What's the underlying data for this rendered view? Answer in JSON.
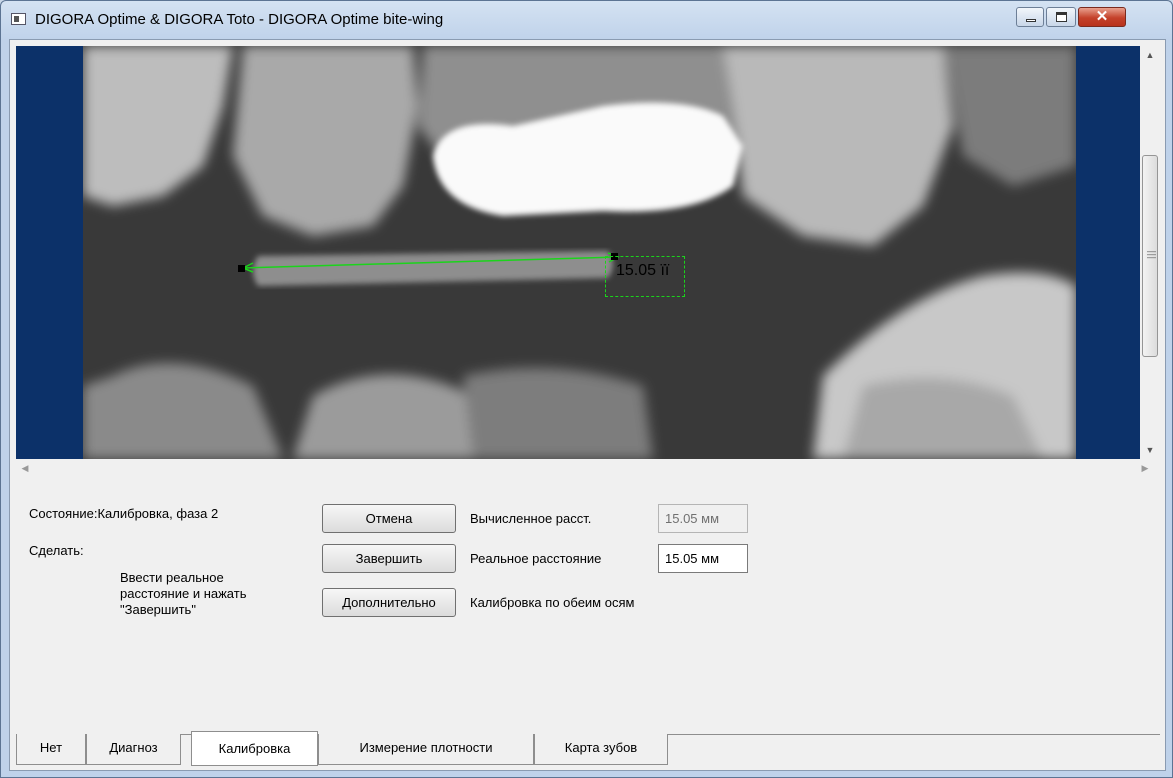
{
  "window": {
    "title": "DIGORA Optime & DIGORA Toto - DIGORA Optime bite-wing",
    "controls": {
      "minimize": "▭",
      "maximize": "▢",
      "close": "✕"
    }
  },
  "image": {
    "measurement_label": "15.05 ïï"
  },
  "panel": {
    "status_label": "Состояние:Калибровка, фаза 2",
    "todo_label": "Сделать:",
    "instruction": "Ввести реальное расстояние и нажать \"Завершить\"",
    "buttons": {
      "cancel": "Отмена",
      "finish": "Завершить",
      "extra": "Дополнительно"
    },
    "calculated_distance_label": "Вычисленное расст.",
    "calculated_distance_value": "15.05 мм",
    "real_distance_label": "Реальное расстояние",
    "real_distance_value": "15.05 мм",
    "both_axes_label": "Калибровка по обеим осям"
  },
  "tabs": [
    {
      "label": "Нет",
      "active": false
    },
    {
      "label": "Диагноз",
      "active": false
    },
    {
      "label": "Калибровка",
      "active": true
    },
    {
      "label": "Измерение плотности",
      "active": false
    },
    {
      "label": "Карта зубов",
      "active": false
    }
  ],
  "colors": {
    "viewer_background": "#0c3169",
    "measurement_line": "#1bd41b"
  }
}
